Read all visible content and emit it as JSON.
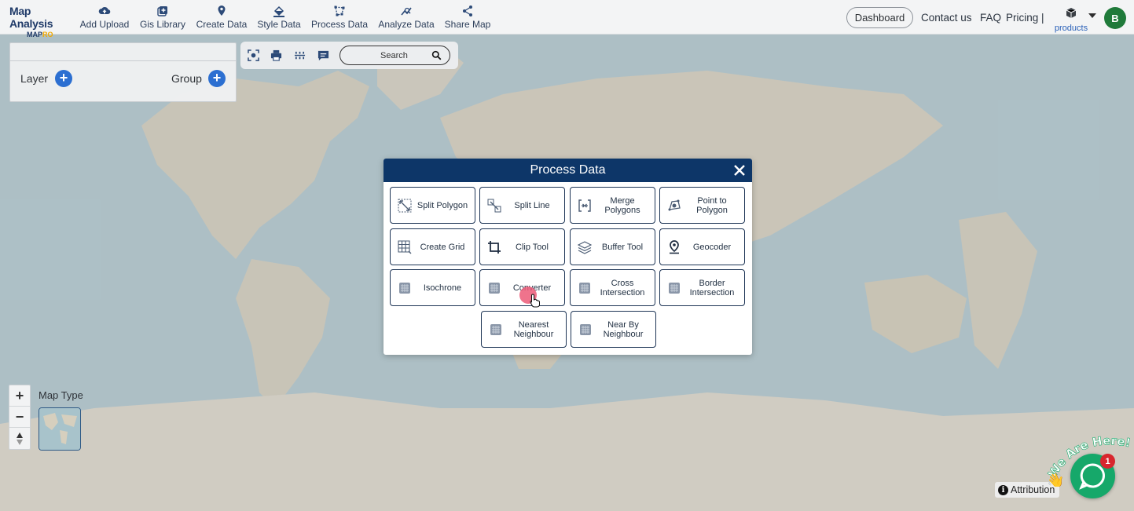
{
  "logo": {
    "line1": "Map Analysis",
    "line2a": "MAP",
    "line2b": "RO"
  },
  "toolbar": [
    {
      "label": "Add Upload",
      "icon": "cloud-upload-icon"
    },
    {
      "label": "Gis Library",
      "icon": "library-add-icon"
    },
    {
      "label": "Create Data",
      "icon": "map-pin-icon"
    },
    {
      "label": "Style Data",
      "icon": "paint-bucket-icon"
    },
    {
      "label": "Process Data",
      "icon": "polygon-icon"
    },
    {
      "label": "Analyze Data",
      "icon": "analyze-icon"
    },
    {
      "label": "Share Map",
      "icon": "share-icon"
    }
  ],
  "header_nav": {
    "dashboard": "Dashboard",
    "contact": "Contact us",
    "faq": "FAQ",
    "pricing": "Pricing |",
    "products": "products",
    "avatar_initial": "B"
  },
  "layer_panel": {
    "layer_label": "Layer",
    "group_label": "Group"
  },
  "mini_toolbar": {
    "search_placeholder": "Search"
  },
  "dialog": {
    "title": "Process Data",
    "buttons": [
      {
        "label": "Split Polygon",
        "icon": "split-polygon-icon"
      },
      {
        "label": "Split Line",
        "icon": "split-line-icon"
      },
      {
        "label": "Merge Polygons",
        "icon": "merge-polygons-icon"
      },
      {
        "label": "Point to Polygon",
        "icon": "point-to-polygon-icon"
      },
      {
        "label": "Create Grid",
        "icon": "grid-icon"
      },
      {
        "label": "Clip Tool",
        "icon": "crop-icon"
      },
      {
        "label": "Buffer Tool",
        "icon": "layers-icon"
      },
      {
        "label": "Geocoder",
        "icon": "location-icon"
      },
      {
        "label": "Isochrone",
        "icon": "process-icon"
      },
      {
        "label": "Converter",
        "icon": "process-icon"
      },
      {
        "label": "Cross Intersection",
        "icon": "process-icon"
      },
      {
        "label": "Border Intersection",
        "icon": "process-icon"
      },
      {
        "label": "Nearest Neighbour",
        "icon": "process-icon"
      },
      {
        "label": "Near By Neighbour",
        "icon": "process-icon"
      }
    ]
  },
  "map_controls": {
    "zoom_in": "+",
    "zoom_out": "−",
    "map_type_label": "Map Type"
  },
  "attribution": "Attribution",
  "chat": {
    "badge": "1",
    "tagline": "We Are Here!"
  },
  "colors": {
    "header_blue": "#0d3668",
    "accent_blue": "#2c6fd1",
    "chat_green": "#16a86a",
    "badge_red": "#d8262e"
  }
}
